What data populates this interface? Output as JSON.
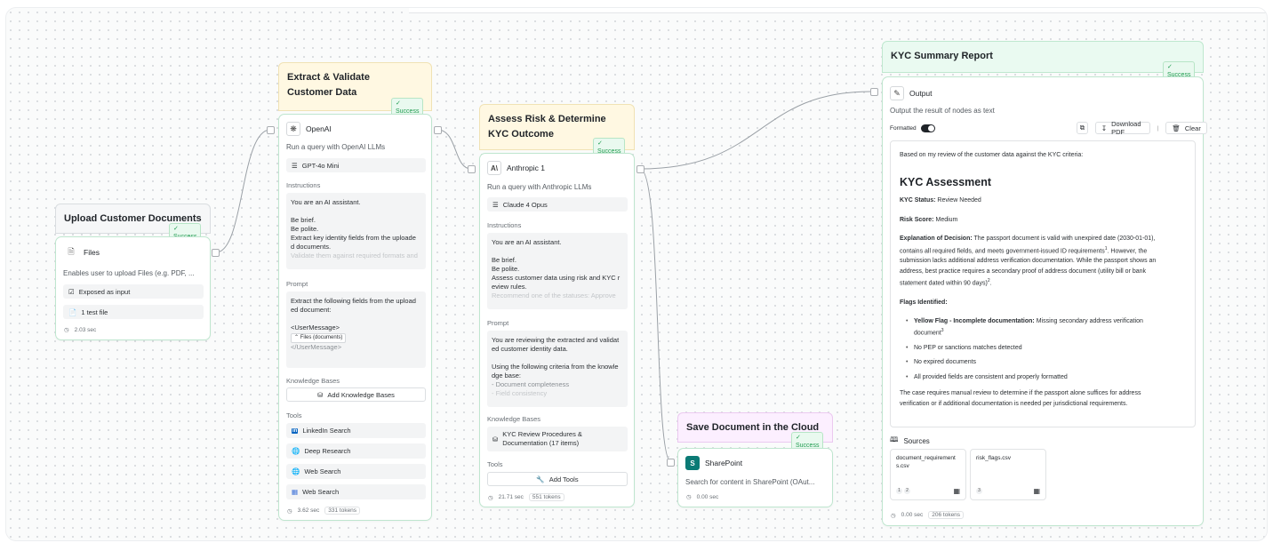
{
  "badge_text": "✓ Success",
  "nodes": {
    "upload": {
      "title": "Upload Customer Documents",
      "card_title": "Files",
      "description": "Enables user to upload Files (e.g. PDF, ...",
      "exposed": "Exposed as input",
      "test_file": "1 test file",
      "time": "2.03 sec"
    },
    "extract": {
      "title_line1": "Extract & Validate",
      "title_line2": "Customer Data",
      "card_title": "OpenAI",
      "description": "Run a query with OpenAI LLMs",
      "model": "GPT-4o Mini",
      "instructions_label": "Instructions",
      "instructions": [
        "You are an AI assistant.",
        "Be brief.",
        "Be polite.",
        "Extract key identity fields from the uploade",
        "d documents."
      ],
      "instructions_fade": "Validate them against required formats and",
      "prompt_label": "Prompt",
      "prompt": [
        "Extract the following fields from the upload",
        "ed document:"
      ],
      "user_msg_open": "<UserMessage>",
      "user_msg_chip": "Files (documents)",
      "user_msg_close": "</UserMessage>",
      "kb_label": "Knowledge Bases",
      "add_kb": "Add Knowledge Bases",
      "tools_label": "Tools",
      "tools": [
        "LinkedIn Search",
        "Deep Research",
        "Web Search",
        "Web Search"
      ],
      "time": "3.62 sec",
      "tokens": "331 tokens"
    },
    "assess": {
      "title_line1": "Assess Risk & Determine",
      "title_line2": "KYC Outcome",
      "card_title": "Anthropic 1",
      "description": "Run a query with Anthropic LLMs",
      "model": "Claude 4 Opus",
      "instructions_label": "Instructions",
      "instructions": [
        "You are an AI assistant.",
        "Be brief.",
        "Be polite.",
        "Assess customer data using risk and KYC r",
        "eview rules."
      ],
      "instructions_fade": "Recommend one of the statuses: Approve",
      "prompt_label": "Prompt",
      "prompt": [
        "You are reviewing the extracted and validat",
        "ed customer identity data.",
        "Using the following criteria from the knowle",
        "dge base:",
        "- Document completeness"
      ],
      "prompt_fade": "- Field consistency",
      "kb_label": "Knowledge Bases",
      "kb_item_line1": "KYC Review Procedures &",
      "kb_item_line2": "Documentation (17 items)",
      "tools_label": "Tools",
      "add_tools": "Add Tools",
      "time": "21.71 sec",
      "tokens": "551 tokens"
    },
    "save": {
      "title": "Save Document in the Cloud",
      "card_title": "SharePoint",
      "description": "Search for content in SharePoint (OAut...",
      "time": "0.00 sec"
    },
    "report": {
      "title": "KYC Summary Report",
      "card_title": "Output",
      "description": "Output the result of nodes as text",
      "formatted": "Formatted",
      "download": "Download PDF",
      "clear": "Clear",
      "intro": "Based on my review of the customer data against the KYC criteria:",
      "heading": "KYC Assessment",
      "status_label": "KYC Status:",
      "status_value": "Review Needed",
      "risk_label": "Risk Score:",
      "risk_value": "Medium",
      "explanation_label": "Explanation of Decision:",
      "explanation_1": "The passport document is valid with unexpired date (2030-01-01),",
      "explanation_2": "contains all required fields, and meets government-issued ID requirements",
      "explanation_2_sup": "1",
      "explanation_3": ". However, the",
      "explanation_4": "submission lacks additional address verification documentation. While the passport shows an",
      "explanation_5": "address, best practice requires a secondary proof of address document (utility bill or bank",
      "explanation_6": "statement dated within 90 days)",
      "explanation_6_sup": "2",
      "explanation_6_end": ".",
      "flags_label": "Flags Identified:",
      "flag1_bold": "Yellow Flag - Incomplete documentation:",
      "flag1_rest": "Missing secondary address verification",
      "flag1_line2": "document",
      "flag1_sup": "3",
      "flag2": "No PEP or sanctions matches detected",
      "flag3": "No expired documents",
      "flag4": "All provided fields are consistent and properly formatted",
      "closing_1": "The case requires manual review to determine if the passport alone suffices for address",
      "closing_2": "verification or if additional documentation is needed per jurisdictional requirements.",
      "sources_label": "Sources",
      "sources": [
        {
          "name_line1": "document_requirement",
          "name_line2": "s.csv",
          "refs": [
            "1",
            "2"
          ]
        },
        {
          "name_line1": "risk_flags.csv",
          "name_line2": "",
          "refs": [
            "3"
          ]
        }
      ],
      "time": "0.00 sec",
      "tokens": "206 tokens"
    }
  }
}
